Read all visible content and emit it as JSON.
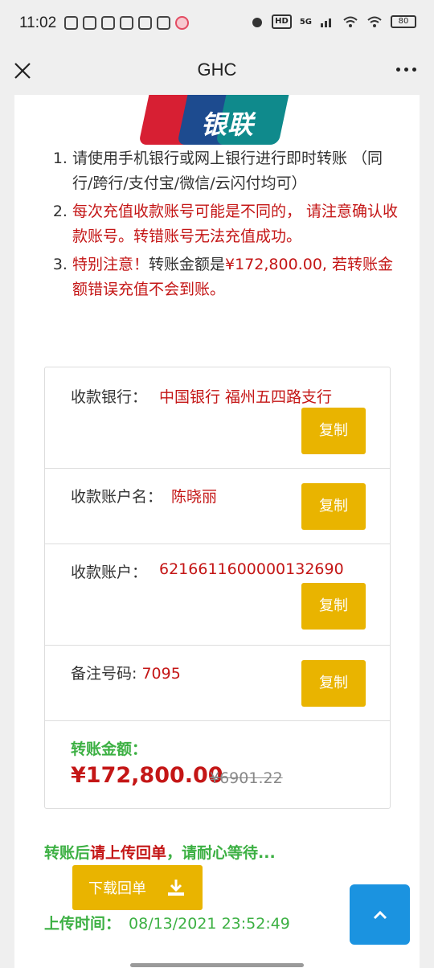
{
  "status_bar": {
    "time": "11:02",
    "hd": "HD",
    "network": "5G",
    "battery": "80"
  },
  "header": {
    "title": "GHC"
  },
  "logo": {
    "text": "银联",
    "colors": [
      "#d71f33",
      "#1d4b8f",
      "#0f8a8c"
    ]
  },
  "instructions": {
    "item1": "请使用手机银行或网上银行进行即时转账 （同行/跨行/支付宝/微信/云闪付均可）",
    "item2": "每次充值收款账号可能是不同的， 请注意确认收款账号。转错账号无法充值成功。",
    "item3_prefix": "特别注意！",
    "item3_mid": "转账金额是",
    "item3_amount": "¥172,800.00",
    "item3_suffix": ", 若转账金额错误充值不会到账。"
  },
  "info": {
    "bank_label": "收款银行：",
    "bank_value": "中国银行 福州五四路支行",
    "name_label": "收款账户名：",
    "name_value": "陈晓丽",
    "account_label": "收款账户：",
    "account_value": "6216611600000132690",
    "note_label": "备注号码: ",
    "note_value": "7095",
    "copy_label": "复制",
    "amount_label": "转账金额：",
    "amount_value": "¥172,800.00",
    "amount_old": "¥6901.22"
  },
  "after": {
    "prefix": "转账后",
    "highlight": "请上传回单",
    "suffix": "，请耐心等待...",
    "download_label": "下载回单",
    "upload_label": "上传时间：",
    "upload_time": "08/13/2021 23:52:49"
  },
  "colors": {
    "accent_yellow": "#e9b400",
    "red": "#c41616",
    "green": "#3cb043",
    "blue": "#1b93e0"
  }
}
